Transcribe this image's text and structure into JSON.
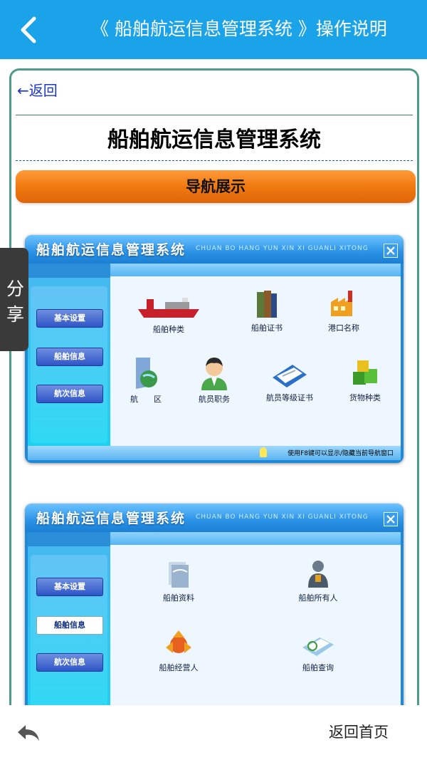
{
  "header": {
    "title": "《 船舶航运信息管理系统 》操作说明"
  },
  "card": {
    "back_link": "←返回",
    "title": "船舶航运信息管理系统",
    "nav_banner": "导航展示"
  },
  "window1": {
    "title": "船舶航运信息管理系统",
    "pinyin": "CHUAN BO HANG YUN XIN XI GUANLI XITONG",
    "sidebar": [
      "基本设置",
      "船舶信息",
      "航次信息"
    ],
    "active_index": 0,
    "items": [
      {
        "label": "船舶种类",
        "icon": "ship-icon"
      },
      {
        "label": "船舶证书",
        "icon": "books-icon"
      },
      {
        "label": "港口名称",
        "icon": "factory-icon"
      },
      {
        "label": "航　　区",
        "icon": "globe-folder-icon"
      },
      {
        "label": "航员职务",
        "icon": "person-icon"
      },
      {
        "label": "航员等级证书",
        "icon": "certificate-icon"
      },
      {
        "label": "货物种类",
        "icon": "cargo-cubes-icon"
      }
    ],
    "status": "使用F8键可以显示/隐藏当前导航窗口"
  },
  "window2": {
    "title": "船舶航运信息管理系统",
    "pinyin": "CHUAN BO HANG YUN XIN XI GUANLI XITONG",
    "sidebar": [
      "基本设置",
      "船舶信息",
      "航次信息"
    ],
    "active_index": 1,
    "items": [
      {
        "label": "船舶资料",
        "icon": "documents-icon"
      },
      {
        "label": "船舶所有人",
        "icon": "owner-icon"
      },
      {
        "label": "船舶经营人",
        "icon": "operator-icon"
      },
      {
        "label": "船舶查询",
        "icon": "search-docs-icon"
      }
    ]
  },
  "share": {
    "line1": "分",
    "line2": "享"
  },
  "footer": {
    "home_link": "返回首页"
  },
  "colors": {
    "header": "#1aa3e8",
    "banner": "#f07a10",
    "window": "#1e88d9"
  }
}
